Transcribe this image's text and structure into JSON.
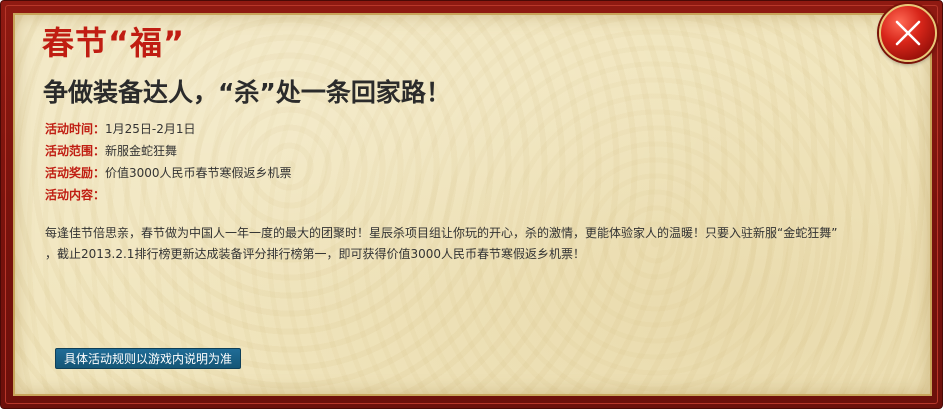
{
  "dialog": {
    "title": "春节“福”",
    "subtitle": "争做装备达人，“杀”处一条回家路！",
    "info": [
      {
        "label": "活动时间：",
        "value": "1月25日-2月1日"
      },
      {
        "label": "活动范围：",
        "value": "新服金蛇狂舞"
      },
      {
        "label": "活动奖励：",
        "value": "价值3000人民币春节寒假返乡机票"
      },
      {
        "label": "活动内容：",
        "value": ""
      }
    ],
    "description_line1": "每逢佳节倍思亲，春节做为中国人一年一度的最大的团聚时！星辰杀项目组让你玩的开心，杀的激情，更能体验家人的温暖！只要入驻新服“金蛇狂舞”",
    "description_line2": "，截止2013.2.1排行榜更新达成装备评分排行榜第一，即可获得价值3000人民币春节寒假返乡机票！",
    "rules_button_label": "具体活动规则以游戏内说明为准",
    "close_icon": "close-x-icon"
  },
  "colors": {
    "frame": "#7a130d",
    "panel": "#f1e6bf",
    "title": "#c01d12",
    "label": "#c01d12",
    "button": "#1a6188"
  }
}
